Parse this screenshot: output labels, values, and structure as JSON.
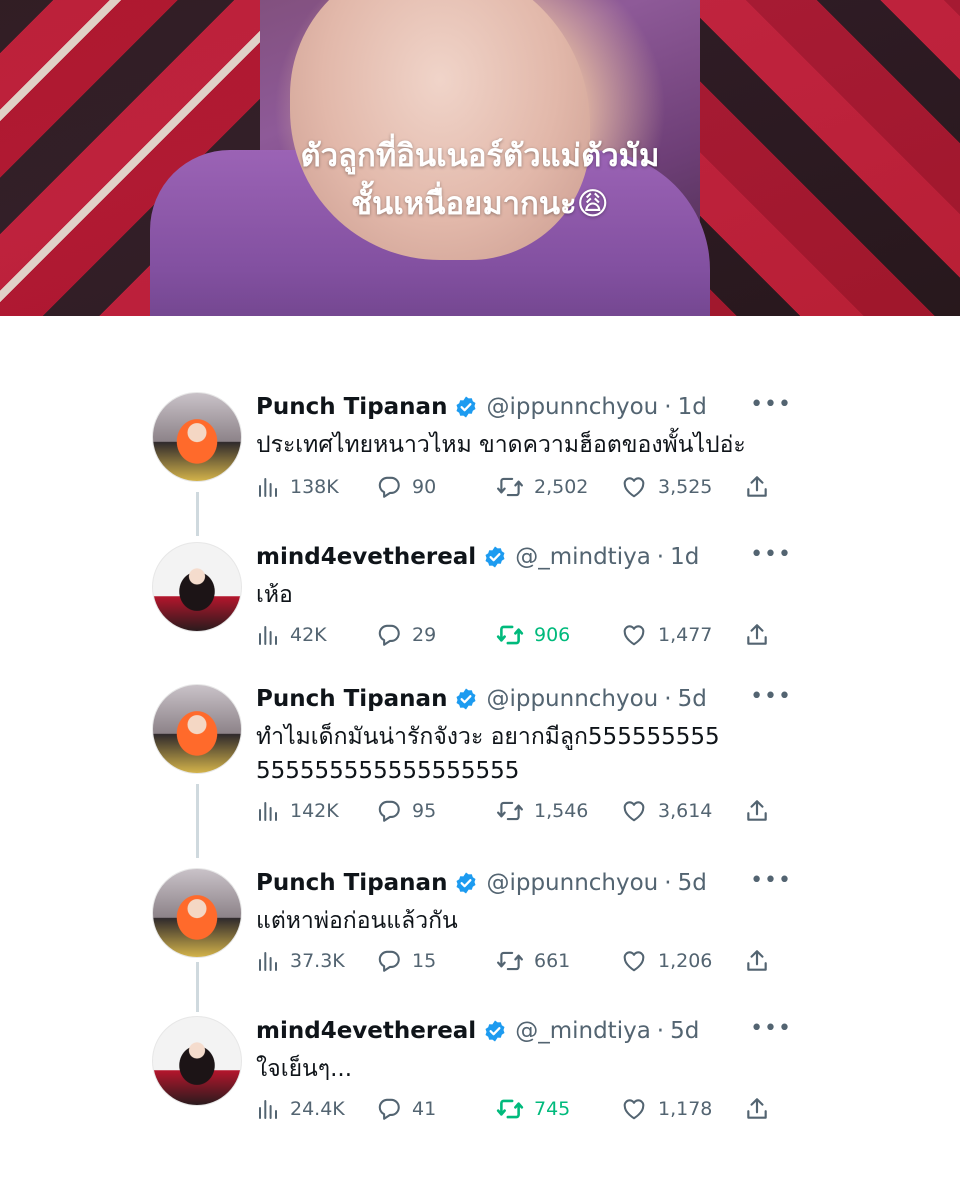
{
  "photo": {
    "caption_line1": "ตัวลูกที่อินเนอร์ตัวแม่ตัวมัม",
    "caption_line2": "ชั้นเหนื่อยมากนะ😩"
  },
  "colors": {
    "verified": "#1d9bf0",
    "retweet_active": "#00ba7c",
    "muted": "#536471",
    "thread_line": "#cfd9de"
  },
  "tweets": [
    {
      "name": "Punch Tipanan",
      "handle": "@ippunnchyou",
      "time": "1d",
      "text": "ประเทศไทยหนาวไหม ขาดความฮ็อตของพั้นไปอ่ะ",
      "views": "138K",
      "replies": "90",
      "retweets": "2,502",
      "likes": "3,525",
      "retweeted": false
    },
    {
      "name": "mind4evethereal",
      "handle": "@_mindtiya",
      "time": "1d",
      "text": "เห้อ",
      "views": "42K",
      "replies": "29",
      "retweets": "906",
      "likes": "1,477",
      "retweeted": true
    },
    {
      "name": "Punch Tipanan",
      "handle": "@ippunnchyou",
      "time": "5d",
      "text": "ทำไมเด็กมันน่ารักจังวะ อยากมีลูก555555555555555555555555555",
      "views": "142K",
      "replies": "95",
      "retweets": "1,546",
      "likes": "3,614",
      "retweeted": false
    },
    {
      "name": "Punch Tipanan",
      "handle": "@ippunnchyou",
      "time": "5d",
      "text": "แต่หาพ่อก่อนแล้วกัน",
      "views": "37.3K",
      "replies": "15",
      "retweets": "661",
      "likes": "1,206",
      "retweeted": false
    },
    {
      "name": "mind4evethereal",
      "handle": "@_mindtiya",
      "time": "5d",
      "text": "ใจเย็นๆ...",
      "views": "24.4K",
      "replies": "41",
      "retweets": "745",
      "likes": "1,178",
      "retweeted": true
    }
  ],
  "icons": {
    "views": "chart-bars-icon",
    "reply": "speech-bubble-icon",
    "retweet": "retweet-icon",
    "like": "heart-icon",
    "share": "share-upload-icon",
    "more": "more-dots-icon",
    "verified": "verified-badge-icon"
  },
  "more_label": "•••"
}
